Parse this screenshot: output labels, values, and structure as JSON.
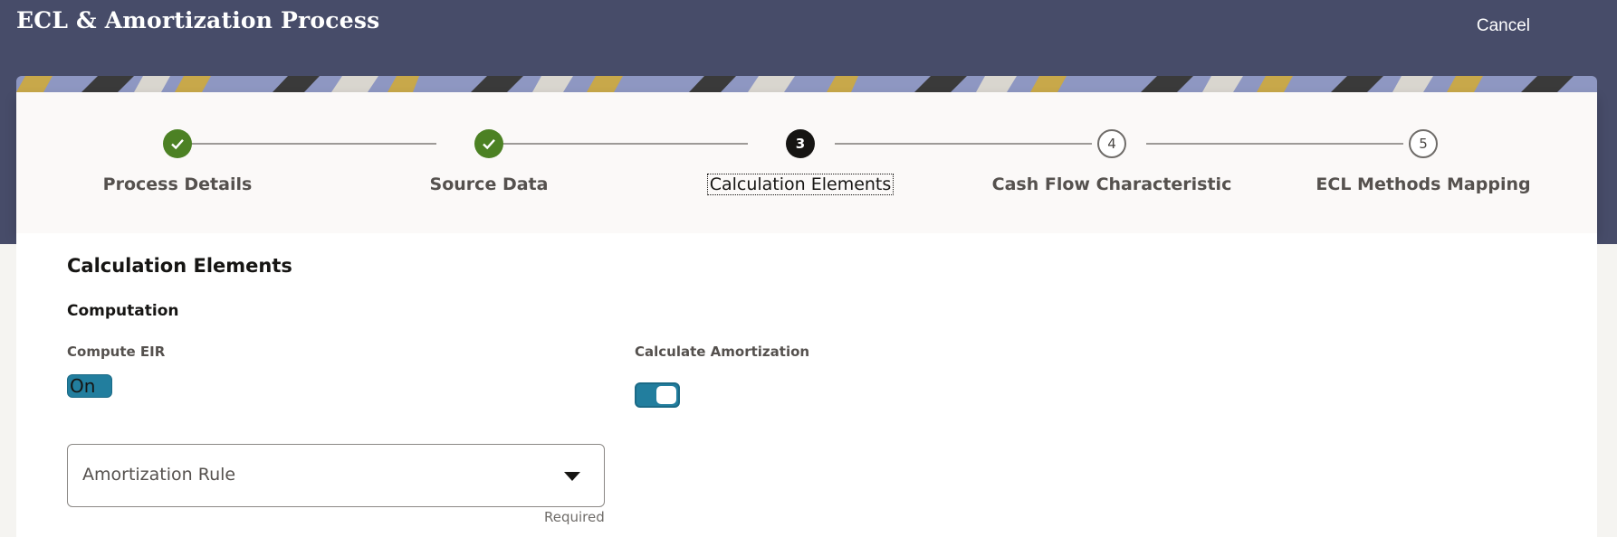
{
  "header": {
    "title": "ECL & Amortization Process",
    "cancel_label": "Cancel",
    "background_color": "#474c69"
  },
  "train": {
    "steps": [
      {
        "number": "",
        "label": "Process Details",
        "state": "completed"
      },
      {
        "number": "",
        "label": "Source Data",
        "state": "completed"
      },
      {
        "number": "3",
        "label": "Calculation Elements",
        "state": "current"
      },
      {
        "number": "4",
        "label": "Cash Flow Characteristic",
        "state": "future"
      },
      {
        "number": "5",
        "label": "ECL Methods Mapping",
        "state": "future"
      }
    ]
  },
  "content": {
    "section_title": "Calculation Elements",
    "subsection_title": "Computation",
    "compute_eir": {
      "label": "Compute EIR",
      "value": "On"
    },
    "calculate_amortization": {
      "label": "Calculate Amortization",
      "on": true
    },
    "amortization_rule": {
      "label": "Amortization Rule",
      "value": "",
      "helper": "Required"
    }
  },
  "colors": {
    "accent": "#227e9e",
    "completed": "#4c8124",
    "current": "#161513"
  }
}
